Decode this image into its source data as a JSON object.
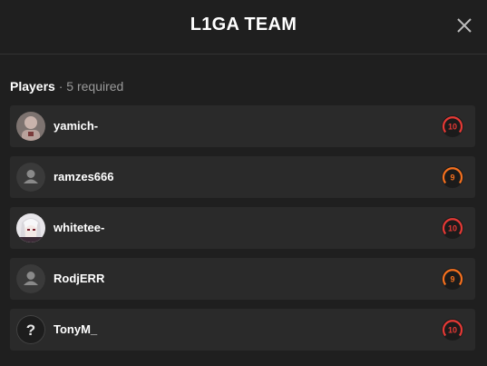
{
  "header": {
    "title": "L1GA TEAM"
  },
  "section": {
    "label": "Players",
    "separator": " · ",
    "requirement": "5 required"
  },
  "players": [
    {
      "name": "yamich-",
      "level": "10",
      "avatar_icon": "user-photo-icon",
      "ring_color": "#e53935"
    },
    {
      "name": "ramzes666",
      "level": "9",
      "avatar_icon": "default-user-icon",
      "ring_color": "#f5701e"
    },
    {
      "name": "whitetee-",
      "level": "10",
      "avatar_icon": "anime-photo-icon",
      "ring_color": "#e53935"
    },
    {
      "name": "RodjERR",
      "level": "9",
      "avatar_icon": "default-user-icon",
      "ring_color": "#f5701e"
    },
    {
      "name": "TonyM_",
      "level": "10",
      "avatar_icon": "question-mark-icon",
      "ring_color": "#e53935"
    }
  ]
}
